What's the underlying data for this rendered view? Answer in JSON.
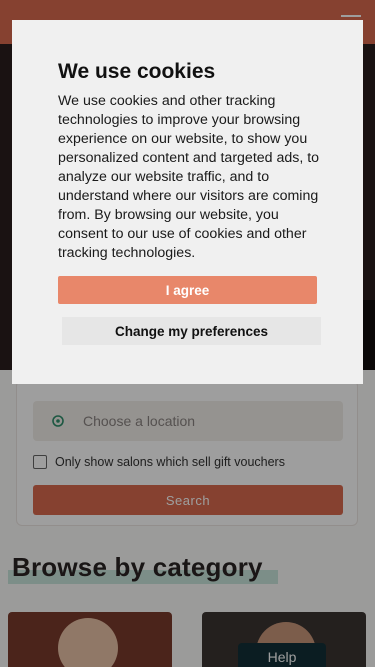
{
  "cookie_dialog": {
    "title": "We use cookies",
    "body": "We use cookies and other tracking technologies to improve your browsing experience on our website, to show you personalized content and targeted ads, to analyze our website traffic, and to understand where our visitors are coming from. By browsing our website, you consent to our use of cookies and other tracking technologies.",
    "agree_label": "I agree",
    "preferences_label": "Change my preferences"
  },
  "search": {
    "location_placeholder": "Choose a location",
    "gift_voucher_label": "Only show salons which sell gift vouchers",
    "gift_voucher_checked": false,
    "search_label": "Search"
  },
  "browse": {
    "title": "Browse by category"
  },
  "help": {
    "label": "Help"
  },
  "colors": {
    "brand": "#d86a4e",
    "agree": "#e8876a",
    "help": "#123037",
    "highlight": "#c8e6dc"
  },
  "icons": {
    "location": "location-pin-icon",
    "menu": "hamburger-menu-icon"
  }
}
